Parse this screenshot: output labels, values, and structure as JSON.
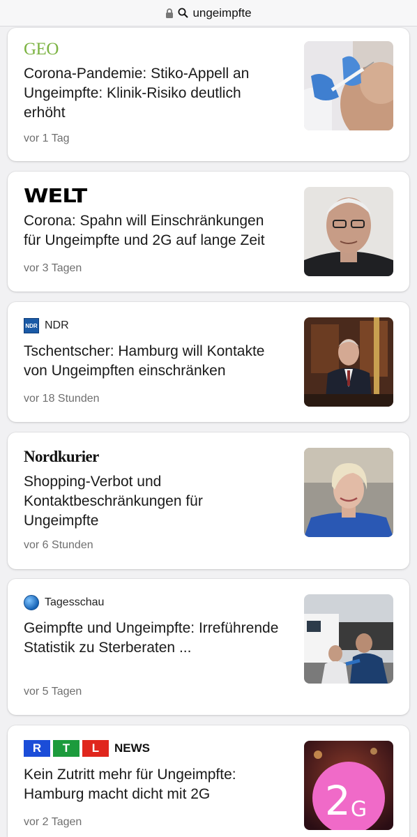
{
  "urlbar": {
    "query": "ungeimpfte",
    "lock_icon": "lock-icon",
    "search_icon": "search-icon"
  },
  "articles": [
    {
      "publisher": "GEO",
      "headline": "Corona-Pandemie: Stiko-Appell an Ungeimpfte: Klinik-Risiko deutlich erhöht",
      "time": "vor 1 Tag",
      "image": "vaccination-photo"
    },
    {
      "publisher": "WELT",
      "headline": "Corona: Spahn will Einschränkungen für Ungeimpfte und 2G auf lange Zeit",
      "time": "vor 3 Tagen",
      "image": "portrait-photo"
    },
    {
      "publisher": "NDR",
      "publisher_icon": "NDR",
      "headline": "Tschentscher: Hamburg will Kontakte von Ungeimpften einschränken",
      "time": "vor 18 Stunden",
      "image": "speaker-photo"
    },
    {
      "publisher": "Nordkurier",
      "headline": "Shopping-Verbot und Kontaktbeschränkungen für Ungeimpfte",
      "time": "vor 6 Stunden",
      "image": "portrait-woman-photo"
    },
    {
      "publisher": "Tagesschau",
      "headline": "Geimpfte und Ungeimpfte: Irreführende Statistik zu Sterberaten ...",
      "time": "vor 5 Tagen",
      "image": "vaccination-bus-photo"
    },
    {
      "publisher_letters": [
        "R",
        "T",
        "L"
      ],
      "publisher_suffix": "NEWS",
      "headline": "Kein Zutritt mehr für Ungeimpfte: Hamburg macht dicht mit 2G",
      "time": "vor 2 Tagen",
      "image": "2g-sign-photo",
      "image_text": "2G"
    }
  ],
  "colors": {
    "geo": "#7cb342",
    "rtl_r": "#1b4dd8",
    "rtl_t": "#1c9b3c",
    "rtl_l": "#e0261d"
  }
}
